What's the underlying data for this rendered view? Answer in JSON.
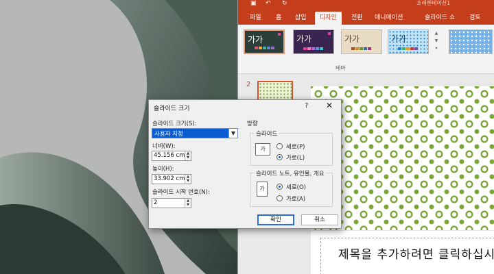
{
  "ppt": {
    "title": "프레젠테이션1",
    "tabs": [
      "파일",
      "홈",
      "삽입",
      "디자인",
      "전환",
      "애니메이션",
      "슬라이드 쇼",
      "검토"
    ],
    "active_tab": "디자인",
    "themes": [
      {
        "label": "가가"
      },
      {
        "label": "가가"
      },
      {
        "label": "가가"
      },
      {
        "label": "가가"
      }
    ],
    "group_label": "테마",
    "slide_number": "2",
    "slide_title": "제목을 추가하려면 클릭하십시오"
  },
  "dialog": {
    "title": "슬라이드 크기",
    "help": "?",
    "close": "✕",
    "size_label": "슬라이드 크기(S):",
    "size_value": "사용자 지정",
    "width_label": "너비(W):",
    "width_value": "45.156 cm",
    "height_label": "높이(H):",
    "height_value": "33.902 cm",
    "start_label": "슬라이드 시작 번호(N):",
    "start_value": "2",
    "orientation_label": "방향",
    "slides_group": "슬라이드",
    "slides_portrait": "세로(P)",
    "slides_landscape": "가로(L)",
    "notes_group": "슬라이드 노트, 유인물, 개요",
    "notes_portrait": "세로(O)",
    "notes_landscape": "가로(A)",
    "ok": "확인",
    "cancel": "취소",
    "orient_icon_a": "가",
    "orient_icon_b": "가"
  },
  "colors": {
    "accent": "#c43e1c",
    "selection": "#0b5cd0",
    "slide_pattern": "#7aa637"
  }
}
